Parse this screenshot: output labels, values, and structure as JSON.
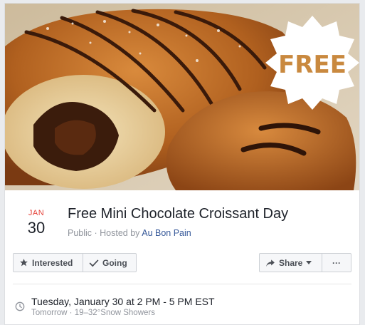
{
  "cover": {
    "badge_text": "FREE",
    "colors": {
      "badge_text": "#c9893f",
      "badge_bg": "#ffffff"
    }
  },
  "event": {
    "month": "JAN",
    "day": "30",
    "title": "Free Mini Chocolate Croissant Day",
    "visibility": "Public",
    "separator": " · ",
    "hosted_prefix": "Hosted by ",
    "host": "Au Bon Pain"
  },
  "actions": {
    "interested_label": "Interested",
    "going_label": "Going",
    "share_label": "Share",
    "more_label": "···"
  },
  "details": {
    "time": "Tuesday, January 30 at 2 PM - 5 PM EST",
    "weather": "Tomorrow · 19–32°Snow Showers"
  },
  "icons": [
    "star-icon",
    "checkmark-icon",
    "share-arrow-icon",
    "caret-down-icon",
    "clock-icon"
  ],
  "colors": {
    "accent_red": "#e5433a",
    "link_blue": "#365899",
    "text_gray": "#90949c"
  }
}
